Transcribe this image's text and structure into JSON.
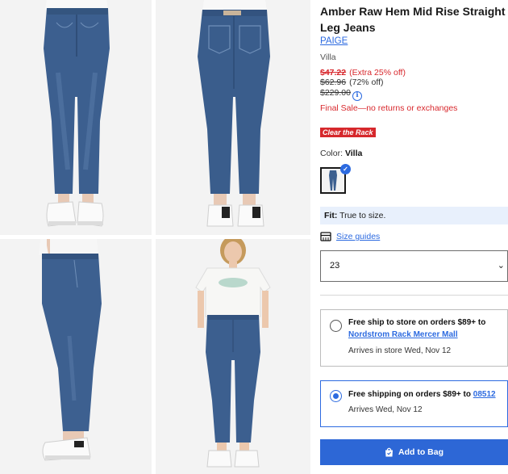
{
  "product": {
    "title": "Amber Raw Hem Mid Rise Straight Leg Jeans",
    "brand": "PAIGE",
    "variant": "Villa"
  },
  "pricing": {
    "sale_price": "$47.22",
    "extra_discount": "(Extra 25% off)",
    "compare_price": "$62.96",
    "percent_off": "(72% off)",
    "original_price": "$229.00",
    "final_sale_note": "Final Sale—no returns or exchanges"
  },
  "badge": {
    "label": "Clear the Rack",
    "color": "#d6282c"
  },
  "color": {
    "label": "Color:",
    "selected": "Villa"
  },
  "fit": {
    "label": "Fit:",
    "value": "True to size."
  },
  "size": {
    "guides_label": "Size guides",
    "selected": "23",
    "chevron": "⌄"
  },
  "shipping": {
    "options": [
      {
        "line1": "Free ship to store on orders $89+ to",
        "store_link": "Nordstrom Rack Mercer Mall",
        "arrival": "Arrives in store Wed, Nov 12",
        "selected": false
      },
      {
        "line1": "Free shipping on orders $89+ to",
        "zip_link": "08512",
        "arrival": "Arrives Wed, Nov 12",
        "selected": true
      }
    ]
  },
  "actions": {
    "add_to_bag": "Add to Bag"
  },
  "icons": {
    "info": "info-icon",
    "size_guide": "ruler-card-icon",
    "bag": "shopping-bag-icon",
    "check": "check-icon"
  },
  "colors": {
    "accent": "#2c6ae0",
    "sale_red": "#d8282d",
    "denim": "#3c5f8f"
  }
}
